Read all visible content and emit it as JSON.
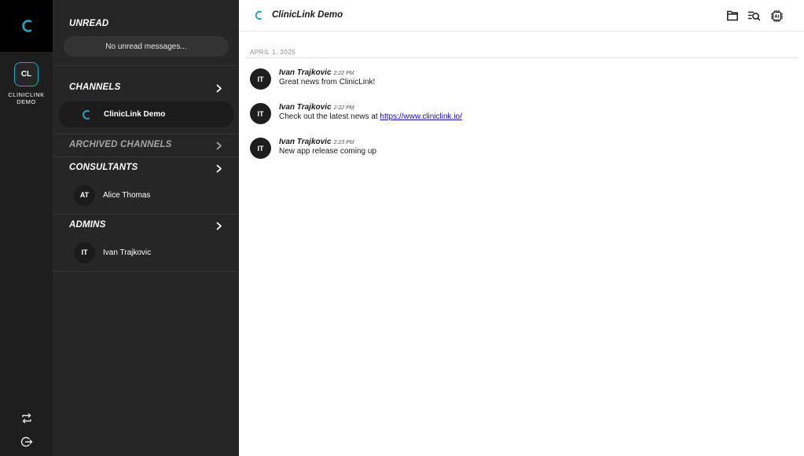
{
  "rail": {
    "workspace_initials": "CL",
    "workspace_name_line1": "CLINICLINK",
    "workspace_name_line2": "DEMO",
    "icons": [
      "cliniclink-logo-icon",
      "switch-icon",
      "logout-icon"
    ]
  },
  "sidebar": {
    "unread": {
      "title": "UNREAD",
      "empty_text": "No unread messages..."
    },
    "channels": {
      "title": "CHANNELS",
      "items": [
        {
          "label": "ClinicLink Demo"
        }
      ]
    },
    "archived": {
      "title": "ARCHIVED CHANNELS"
    },
    "consultants": {
      "title": "CONSULTANTS",
      "items": [
        {
          "initials": "AT",
          "name": "Alice Thomas"
        }
      ]
    },
    "admins": {
      "title": "ADMINS",
      "items": [
        {
          "initials": "IT",
          "name": "Ivan Trajkovic"
        }
      ]
    }
  },
  "header": {
    "title": "ClinicLink Demo",
    "icons": [
      "files-icon",
      "search-messages-icon",
      "ai-chip-icon"
    ]
  },
  "messages": {
    "date_separator": "APRIL 1, 2025",
    "items": [
      {
        "initials": "IT",
        "author": "Ivan Trajkovic",
        "time": "2:22 PM",
        "text": "Great news from ClinicLink!"
      },
      {
        "initials": "IT",
        "author": "Ivan Trajkovic",
        "time": "2:22 PM",
        "text": "Check out the latest news at ",
        "link": "https://www.cliniclink.io/"
      },
      {
        "initials": "IT",
        "author": "Ivan Trajkovic",
        "time": "2:23 PM",
        "text": "New app release coming up"
      }
    ]
  },
  "colors": {
    "accent": "#1fa6c4",
    "rail_bg": "#1e1e1e",
    "sidebar_bg": "#262626",
    "link": "#1a0dab"
  }
}
